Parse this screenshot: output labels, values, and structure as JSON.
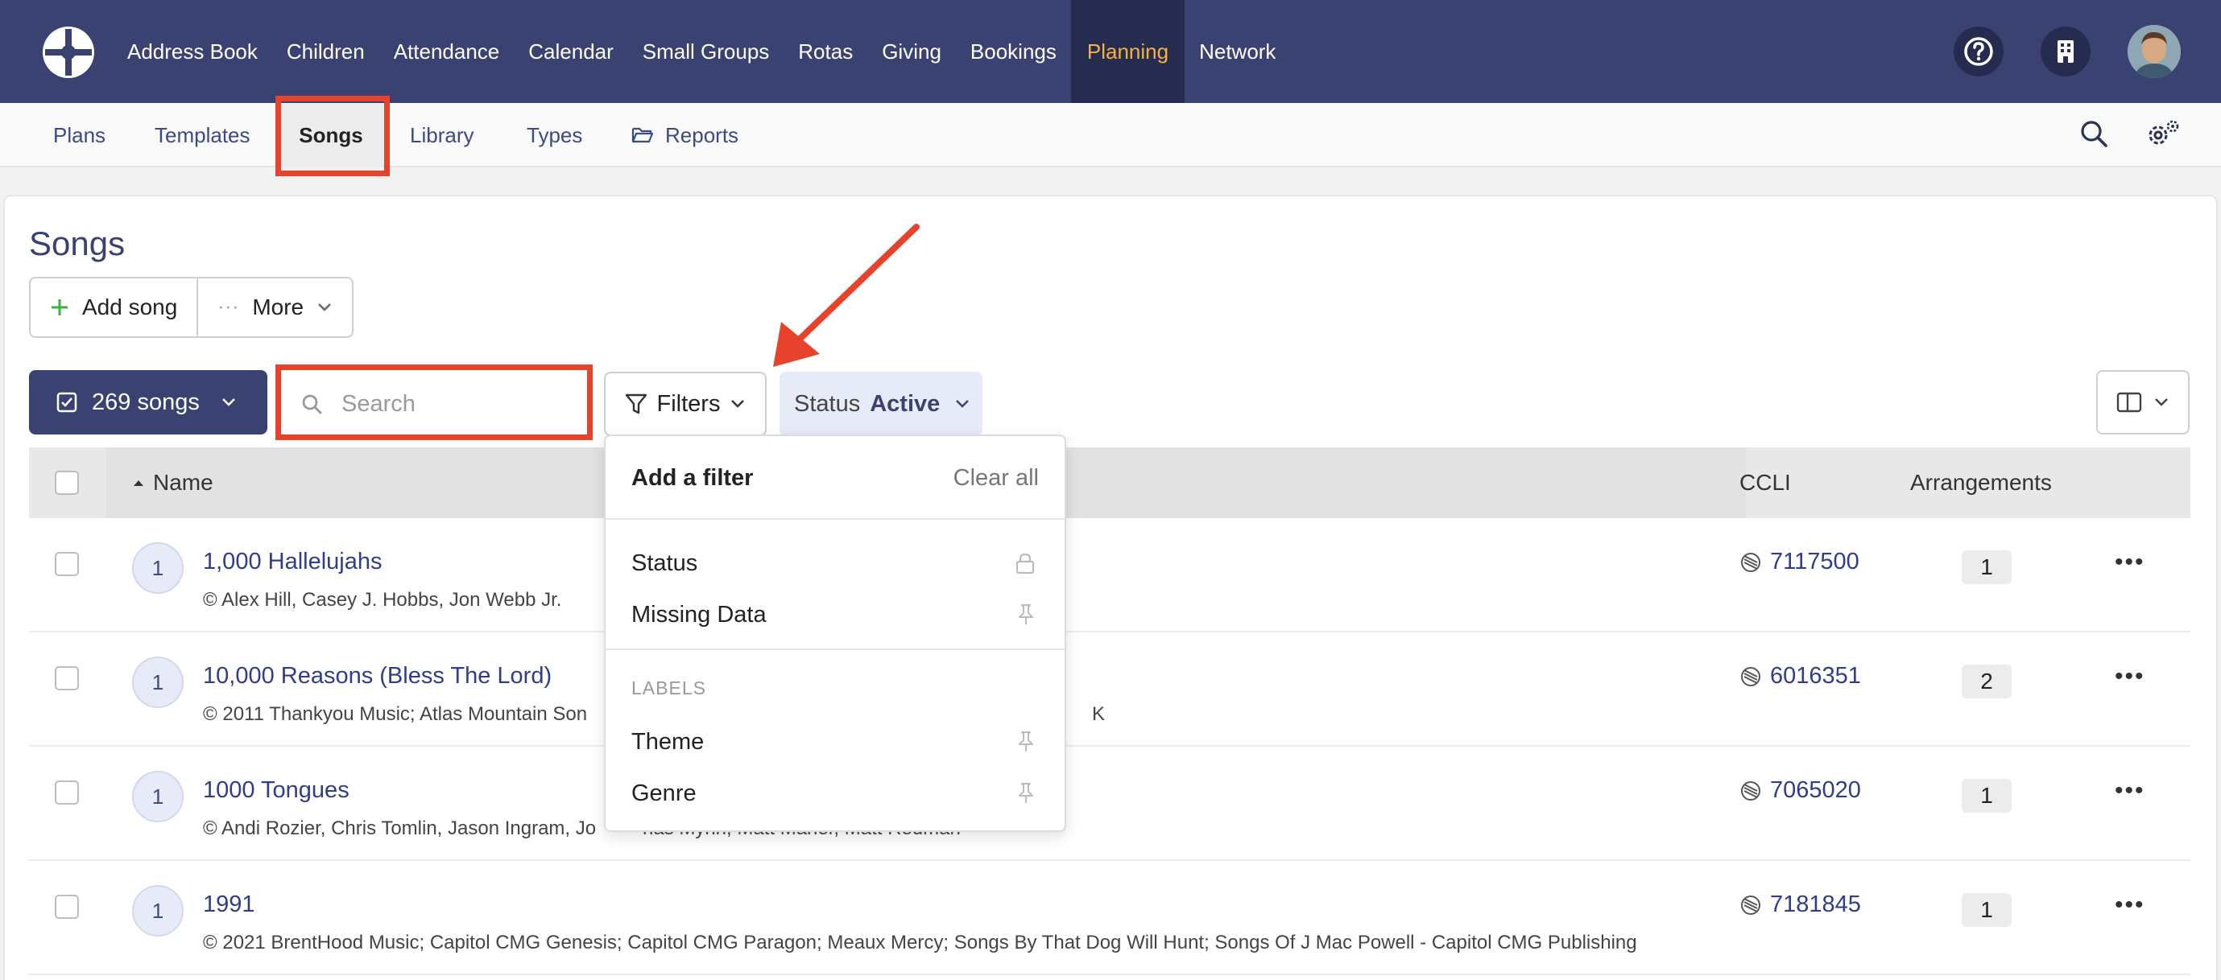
{
  "topnav": {
    "items": [
      {
        "label": "Address Book"
      },
      {
        "label": "Children"
      },
      {
        "label": "Attendance"
      },
      {
        "label": "Calendar"
      },
      {
        "label": "Small Groups"
      },
      {
        "label": "Rotas"
      },
      {
        "label": "Giving"
      },
      {
        "label": "Bookings"
      },
      {
        "label": "Planning"
      },
      {
        "label": "Network"
      }
    ],
    "active": "Planning",
    "icons": [
      "help-icon",
      "building-icon",
      "avatar"
    ]
  },
  "subnav": {
    "items": [
      {
        "label": "Plans"
      },
      {
        "label": "Templates"
      },
      {
        "label": "Songs"
      },
      {
        "label": "Library"
      },
      {
        "label": "Types"
      },
      {
        "label": "Reports"
      }
    ],
    "active": "Songs",
    "icons": [
      "search-icon",
      "settings-icon"
    ]
  },
  "page": {
    "title": "Songs",
    "add_song": "Add song",
    "more": "More",
    "songs_count": "269 songs",
    "search_placeholder": "Search",
    "filters": "Filters",
    "status_label": "Status",
    "status_value": "Active"
  },
  "table": {
    "headers": {
      "name": "Name",
      "ccli": "CCLI",
      "arrangements": "Arrangements"
    },
    "rows": [
      {
        "badge": "1",
        "name": "1,000 Hallelujahs",
        "copyright": "© Alex Hill, Casey J. Hobbs, Jon Webb Jr.",
        "ccli": "7117500",
        "arrangements": "1"
      },
      {
        "badge": "1",
        "name": "10,000 Reasons (Bless The Lord)",
        "copyright": "© 2011 Thankyou Music; Atlas Mountain Son",
        "copyright_tail": "K",
        "ccli": "6016351",
        "arrangements": "2"
      },
      {
        "badge": "1",
        "name": "1000 Tongues",
        "copyright": "© Andi Rozier, Chris Tomlin, Jason Ingram, Jo",
        "copyright_tail": "nas Myrin, Matt Maher, Matt Redman",
        "ccli": "7065020",
        "arrangements": "1"
      },
      {
        "badge": "1",
        "name": "1991",
        "copyright": "© 2021 BrentHood Music; Capitol CMG Genesis; Capitol CMG Paragon; Meaux Mercy; Songs By That Dog Will Hunt; Songs Of J Mac Powell - Capitol CMG Publishing",
        "ccli": "7181845",
        "arrangements": "1"
      }
    ]
  },
  "filter_dropdown": {
    "title": "Add a filter",
    "clear": "Clear all",
    "items": [
      {
        "label": "Status",
        "icon": "lock-icon"
      },
      {
        "label": "Missing Data",
        "icon": "pin-icon"
      }
    ],
    "section": "LABELS",
    "label_items": [
      {
        "label": "Theme",
        "icon": "pin-icon"
      },
      {
        "label": "Genre",
        "icon": "pin-icon"
      }
    ]
  },
  "colors": {
    "nav_bg": "#3a4272",
    "active_nav": "#f3b33d",
    "annotation": "#e8412c",
    "link": "#2f3d8a"
  }
}
